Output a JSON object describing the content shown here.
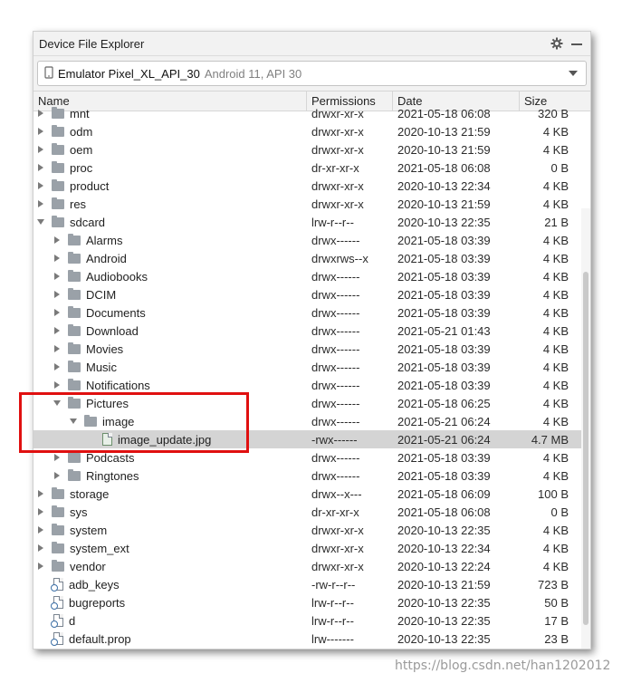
{
  "window": {
    "title": "Device File Explorer"
  },
  "device": {
    "name": "Emulator Pixel_XL_API_30",
    "detail": "Android 11, API 30"
  },
  "columns": {
    "name": "Name",
    "permissions": "Permissions",
    "date": "Date",
    "size": "Size"
  },
  "rows": [
    {
      "name": "mnt",
      "perm": "drwxr-xr-x",
      "date": "2021-05-18 06:08",
      "size": "320 B"
    },
    {
      "name": "odm",
      "perm": "drwxr-xr-x",
      "date": "2020-10-13 21:59",
      "size": "4 KB"
    },
    {
      "name": "oem",
      "perm": "drwxr-xr-x",
      "date": "2020-10-13 21:59",
      "size": "4 KB"
    },
    {
      "name": "proc",
      "perm": "dr-xr-xr-x",
      "date": "2021-05-18 06:08",
      "size": "0 B"
    },
    {
      "name": "product",
      "perm": "drwxr-xr-x",
      "date": "2020-10-13 22:34",
      "size": "4 KB"
    },
    {
      "name": "res",
      "perm": "drwxr-xr-x",
      "date": "2020-10-13 21:59",
      "size": "4 KB"
    },
    {
      "name": "sdcard",
      "perm": "lrw-r--r--",
      "date": "2020-10-13 22:35",
      "size": "21 B"
    },
    {
      "name": "Alarms",
      "perm": "drwx------",
      "date": "2021-05-18 03:39",
      "size": "4 KB"
    },
    {
      "name": "Android",
      "perm": "drwxrws--x",
      "date": "2021-05-18 03:39",
      "size": "4 KB"
    },
    {
      "name": "Audiobooks",
      "perm": "drwx------",
      "date": "2021-05-18 03:39",
      "size": "4 KB"
    },
    {
      "name": "DCIM",
      "perm": "drwx------",
      "date": "2021-05-18 03:39",
      "size": "4 KB"
    },
    {
      "name": "Documents",
      "perm": "drwx------",
      "date": "2021-05-18 03:39",
      "size": "4 KB"
    },
    {
      "name": "Download",
      "perm": "drwx------",
      "date": "2021-05-21 01:43",
      "size": "4 KB"
    },
    {
      "name": "Movies",
      "perm": "drwx------",
      "date": "2021-05-18 03:39",
      "size": "4 KB"
    },
    {
      "name": "Music",
      "perm": "drwx------",
      "date": "2021-05-18 03:39",
      "size": "4 KB"
    },
    {
      "name": "Notifications",
      "perm": "drwx------",
      "date": "2021-05-18 03:39",
      "size": "4 KB"
    },
    {
      "name": "Pictures",
      "perm": "drwx------",
      "date": "2021-05-18 06:25",
      "size": "4 KB"
    },
    {
      "name": "image",
      "perm": "drwx------",
      "date": "2021-05-21 06:24",
      "size": "4 KB"
    },
    {
      "name": "image_update.jpg",
      "perm": "-rwx------",
      "date": "2021-05-21 06:24",
      "size": "4.7 MB"
    },
    {
      "name": "Podcasts",
      "perm": "drwx------",
      "date": "2021-05-18 03:39",
      "size": "4 KB"
    },
    {
      "name": "Ringtones",
      "perm": "drwx------",
      "date": "2021-05-18 03:39",
      "size": "4 KB"
    },
    {
      "name": "storage",
      "perm": "drwx--x---",
      "date": "2021-05-18 06:09",
      "size": "100 B"
    },
    {
      "name": "sys",
      "perm": "dr-xr-xr-x",
      "date": "2021-05-18 06:08",
      "size": "0 B"
    },
    {
      "name": "system",
      "perm": "drwxr-xr-x",
      "date": "2020-10-13 22:35",
      "size": "4 KB"
    },
    {
      "name": "system_ext",
      "perm": "drwxr-xr-x",
      "date": "2020-10-13 22:34",
      "size": "4 KB"
    },
    {
      "name": "vendor",
      "perm": "drwxr-xr-x",
      "date": "2020-10-13 22:24",
      "size": "4 KB"
    },
    {
      "name": "adb_keys",
      "perm": "-rw-r--r--",
      "date": "2020-10-13 21:59",
      "size": "723 B"
    },
    {
      "name": "bugreports",
      "perm": "lrw-r--r--",
      "date": "2020-10-13 22:35",
      "size": "50 B"
    },
    {
      "name": "d",
      "perm": "lrw-r--r--",
      "date": "2020-10-13 22:35",
      "size": "17 B"
    },
    {
      "name": "default.prop",
      "perm": "lrw-------",
      "date": "2020-10-13 22:35",
      "size": "23 B"
    }
  ],
  "watermark": "https://blog.csdn.net/han1202012"
}
